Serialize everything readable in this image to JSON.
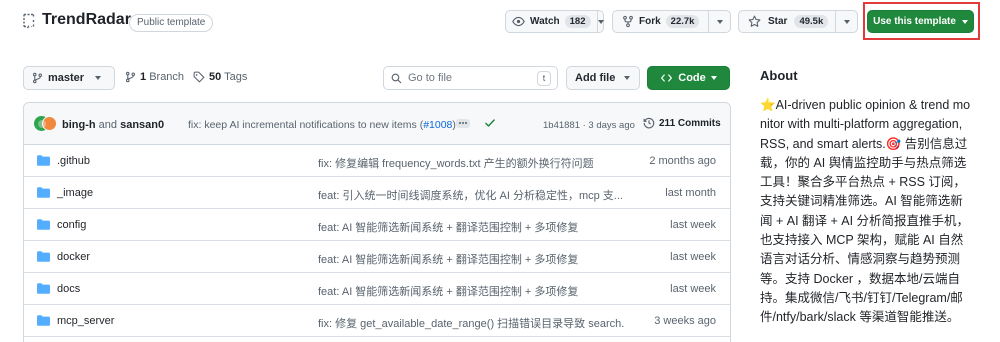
{
  "header": {
    "repo_name": "TrendRadar",
    "label": "Public template",
    "watch": {
      "label": "Watch",
      "count": "182"
    },
    "fork": {
      "label": "Fork",
      "count": "22.7k"
    },
    "star": {
      "label": "Star",
      "count": "49.5k"
    },
    "use_template": "Use this template"
  },
  "toolbar": {
    "branch": "master",
    "branches_count": "1",
    "branches_label": "Branch",
    "tags_count": "50",
    "tags_label": "Tags",
    "goto_placeholder": "Go to file",
    "goto_shortcut": "t",
    "add_file": "Add file",
    "code": "Code"
  },
  "commit": {
    "author1": "bing-h",
    "and": "and",
    "author2": "sansan0",
    "message": "fix: keep AI incremental notifications to new items (",
    "pr": "#1008",
    "message_end": ")",
    "meta": "1b41881 · 3 days ago",
    "commits_label": "211 Commits"
  },
  "files": [
    {
      "name": ".github",
      "message": "fix: 修复编辑 frequency_words.txt 产生的额外换行符问题",
      "time": "2 months ago"
    },
    {
      "name": "_image",
      "message": "feat: 引入统一时间线调度系统，优化 AI 分析稳定性，mcp 支...",
      "time": "last month"
    },
    {
      "name": "config",
      "message": "feat: AI 智能筛选新闻系统 + 翻译范围控制 + 多项修复",
      "time": "last week"
    },
    {
      "name": "docker",
      "message": "feat: AI 智能筛选新闻系统 + 翻译范围控制 + 多项修复",
      "time": "last week"
    },
    {
      "name": "docs",
      "message": "feat: AI 智能筛选新闻系统 + 翻译范围控制 + 多项修复",
      "time": "last week"
    },
    {
      "name": "mcp_server",
      "message": "fix: 修复 get_available_date_range() 扫描错误目录导致 search...",
      "time": "3 weeks ago"
    }
  ],
  "about": {
    "title": "About",
    "description": "⭐AI-driven public opinion & trend monitor with multi-platform aggregation, RSS, and smart alerts.🎯 告别信息过载，你的 AI 舆情监控助手与热点筛选工具！聚合多平台热点 + RSS 订阅，支持关键词精准筛选。AI 智能筛选新闻 + AI 翻译 + AI 分析简报直推手机，也支持接入 MCP 架构，赋能 AI 自然语言对话分析、情感洞察与趋势预测等。支持 Docker ，数据本地/云端自持。集成微信/飞书/钉钉/Telegram/邮件/ntfy/bark/slack 等渠道智能推送。"
  },
  "colors": {
    "primary_green": "#1f883d",
    "link_blue": "#0969da",
    "folder_blue": "#54aeff",
    "highlight_red": "#e03a3a"
  }
}
